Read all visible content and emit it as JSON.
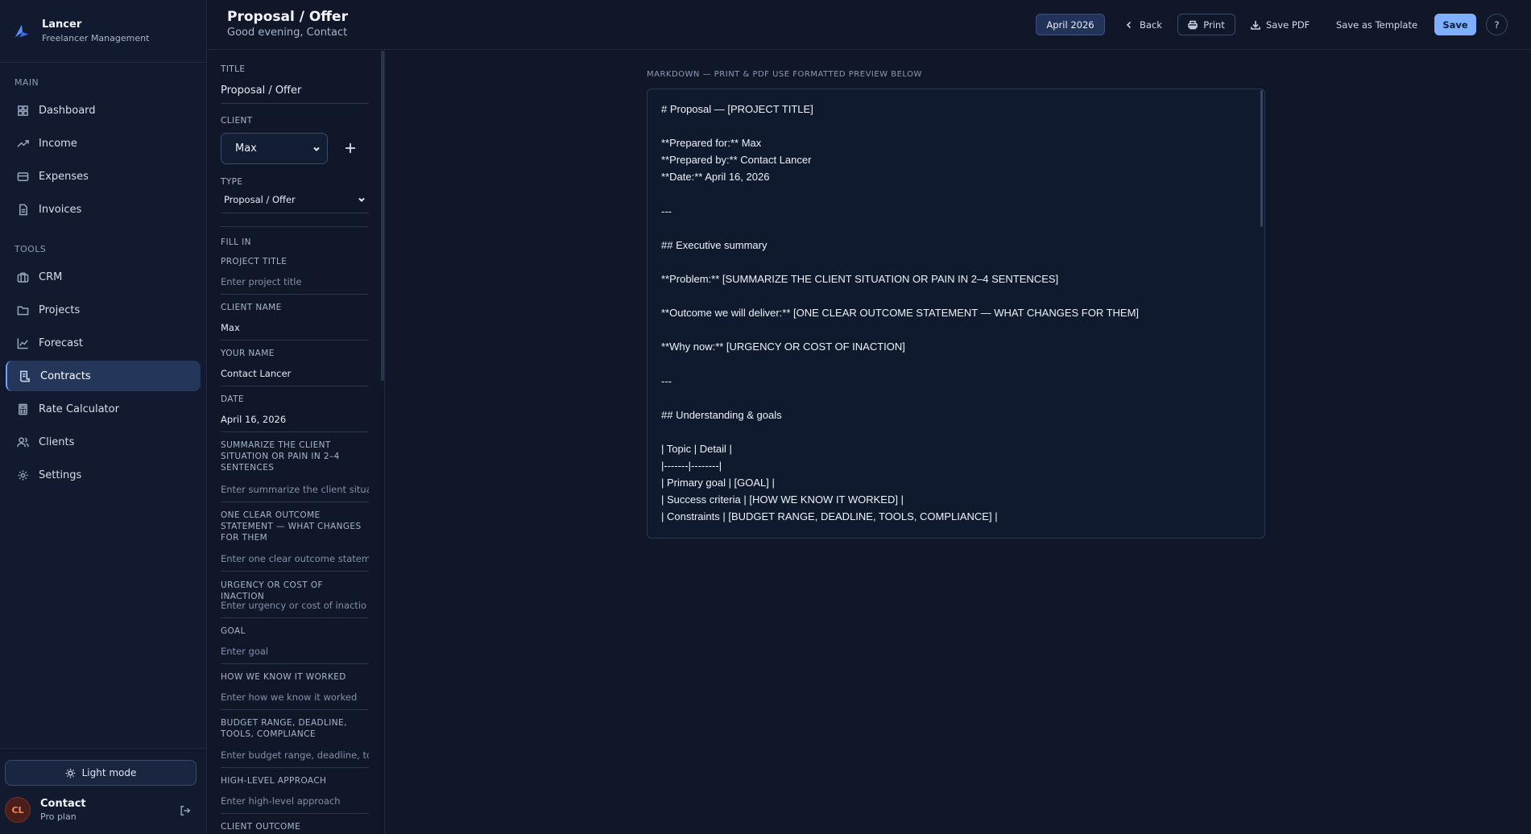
{
  "brand": {
    "name": "Lancer",
    "subtitle": "Freelancer Management"
  },
  "sidebar": {
    "sections": [
      {
        "label": "MAIN",
        "items": [
          {
            "label": "Dashboard",
            "icon": "dashboard-icon"
          },
          {
            "label": "Income",
            "icon": "trending-up-icon"
          },
          {
            "label": "Expenses",
            "icon": "credit-card-icon"
          },
          {
            "label": "Invoices",
            "icon": "file-text-icon"
          }
        ]
      },
      {
        "label": "TOOLS",
        "items": [
          {
            "label": "CRM",
            "icon": "briefcase-icon"
          },
          {
            "label": "Projects",
            "icon": "folder-icon"
          },
          {
            "label": "Forecast",
            "icon": "line-chart-icon"
          },
          {
            "label": "Contracts",
            "icon": "contract-icon",
            "active": true
          },
          {
            "label": "Rate Calculator",
            "icon": "calculator-icon"
          },
          {
            "label": "Clients",
            "icon": "users-icon"
          },
          {
            "label": "Settings",
            "icon": "gear-icon"
          }
        ]
      }
    ],
    "mode_toggle": "Light mode",
    "user": {
      "initials": "CL",
      "name": "Contact",
      "plan": "Pro plan"
    }
  },
  "header": {
    "title": "Proposal / Offer",
    "greeting": "Good evening, Contact",
    "month": "April 2026",
    "back": "Back",
    "print": "Print",
    "save_pdf": "Save PDF",
    "save_template": "Save as Template",
    "save": "Save",
    "help": "?"
  },
  "form": {
    "title_label": "TITLE",
    "title_value": "Proposal / Offer",
    "client_label": "CLIENT",
    "client_value": "Max",
    "type_label": "TYPE",
    "type_value": "Proposal / Offer",
    "fill_in_label": "FILL IN",
    "fields": [
      {
        "label": "PROJECT TITLE",
        "value": "",
        "placeholder": "Enter project title"
      },
      {
        "label": "CLIENT NAME",
        "value": "Max",
        "placeholder": ""
      },
      {
        "label": "YOUR NAME",
        "value": "Contact Lancer",
        "placeholder": ""
      },
      {
        "label": "DATE",
        "value": "April 16, 2026",
        "placeholder": ""
      },
      {
        "label": "SUMMARIZE THE CLIENT SITUATION OR PAIN IN 2–4 SENTENCES",
        "value": "",
        "placeholder": "Enter summarize the client situa"
      },
      {
        "label": "ONE CLEAR OUTCOME STATEMENT — WHAT CHANGES FOR THEM",
        "value": "",
        "placeholder": "Enter one clear outcome statem"
      },
      {
        "label": "URGENCY OR COST OF INACTION",
        "value": "",
        "placeholder": "Enter urgency or cost of inactio"
      },
      {
        "label": "GOAL",
        "value": "",
        "placeholder": "Enter goal"
      },
      {
        "label": "HOW WE KNOW IT WORKED",
        "value": "",
        "placeholder": "Enter how we know it worked"
      },
      {
        "label": "BUDGET RANGE, DEADLINE, TOOLS, COMPLIANCE",
        "value": "",
        "placeholder": "Enter budget range, deadline, to"
      },
      {
        "label": "HIGH-LEVEL APPROACH",
        "value": "",
        "placeholder": "Enter high-level approach"
      },
      {
        "label": "CLIENT OUTCOME",
        "value": "",
        "placeholder": ""
      }
    ]
  },
  "editor": {
    "caption": "MARKDOWN — PRINT & PDF USE FORMATTED PREVIEW BELOW",
    "lines": [
      "# Proposal — [PROJECT TITLE]",
      "",
      "**Prepared for:** Max",
      "**Prepared by:** Contact Lancer",
      "**Date:** April 16, 2026",
      "",
      "---",
      "",
      "## Executive summary",
      "",
      "**Problem:** [SUMMARIZE THE CLIENT SITUATION OR PAIN IN 2–4 SENTENCES]",
      "",
      "**Outcome we will deliver:** [ONE CLEAR OUTCOME STATEMENT — WHAT CHANGES FOR THEM]",
      "",
      "**Why now:** [URGENCY OR COST OF INACTION]",
      "",
      "---",
      "",
      "## Understanding & goals",
      "",
      "| Topic | Detail |",
      "|-------|--------|",
      "| Primary goal | [GOAL] |",
      "| Success criteria | [HOW WE KNOW IT WORKED] |",
      "| Constraints | [BUDGET RANGE, DEADLINE, TOOLS, COMPLIANCE] |"
    ]
  },
  "colors": {
    "accent": "#7fb0ff",
    "active_nav": "#24365a",
    "background": "#0f1729"
  }
}
